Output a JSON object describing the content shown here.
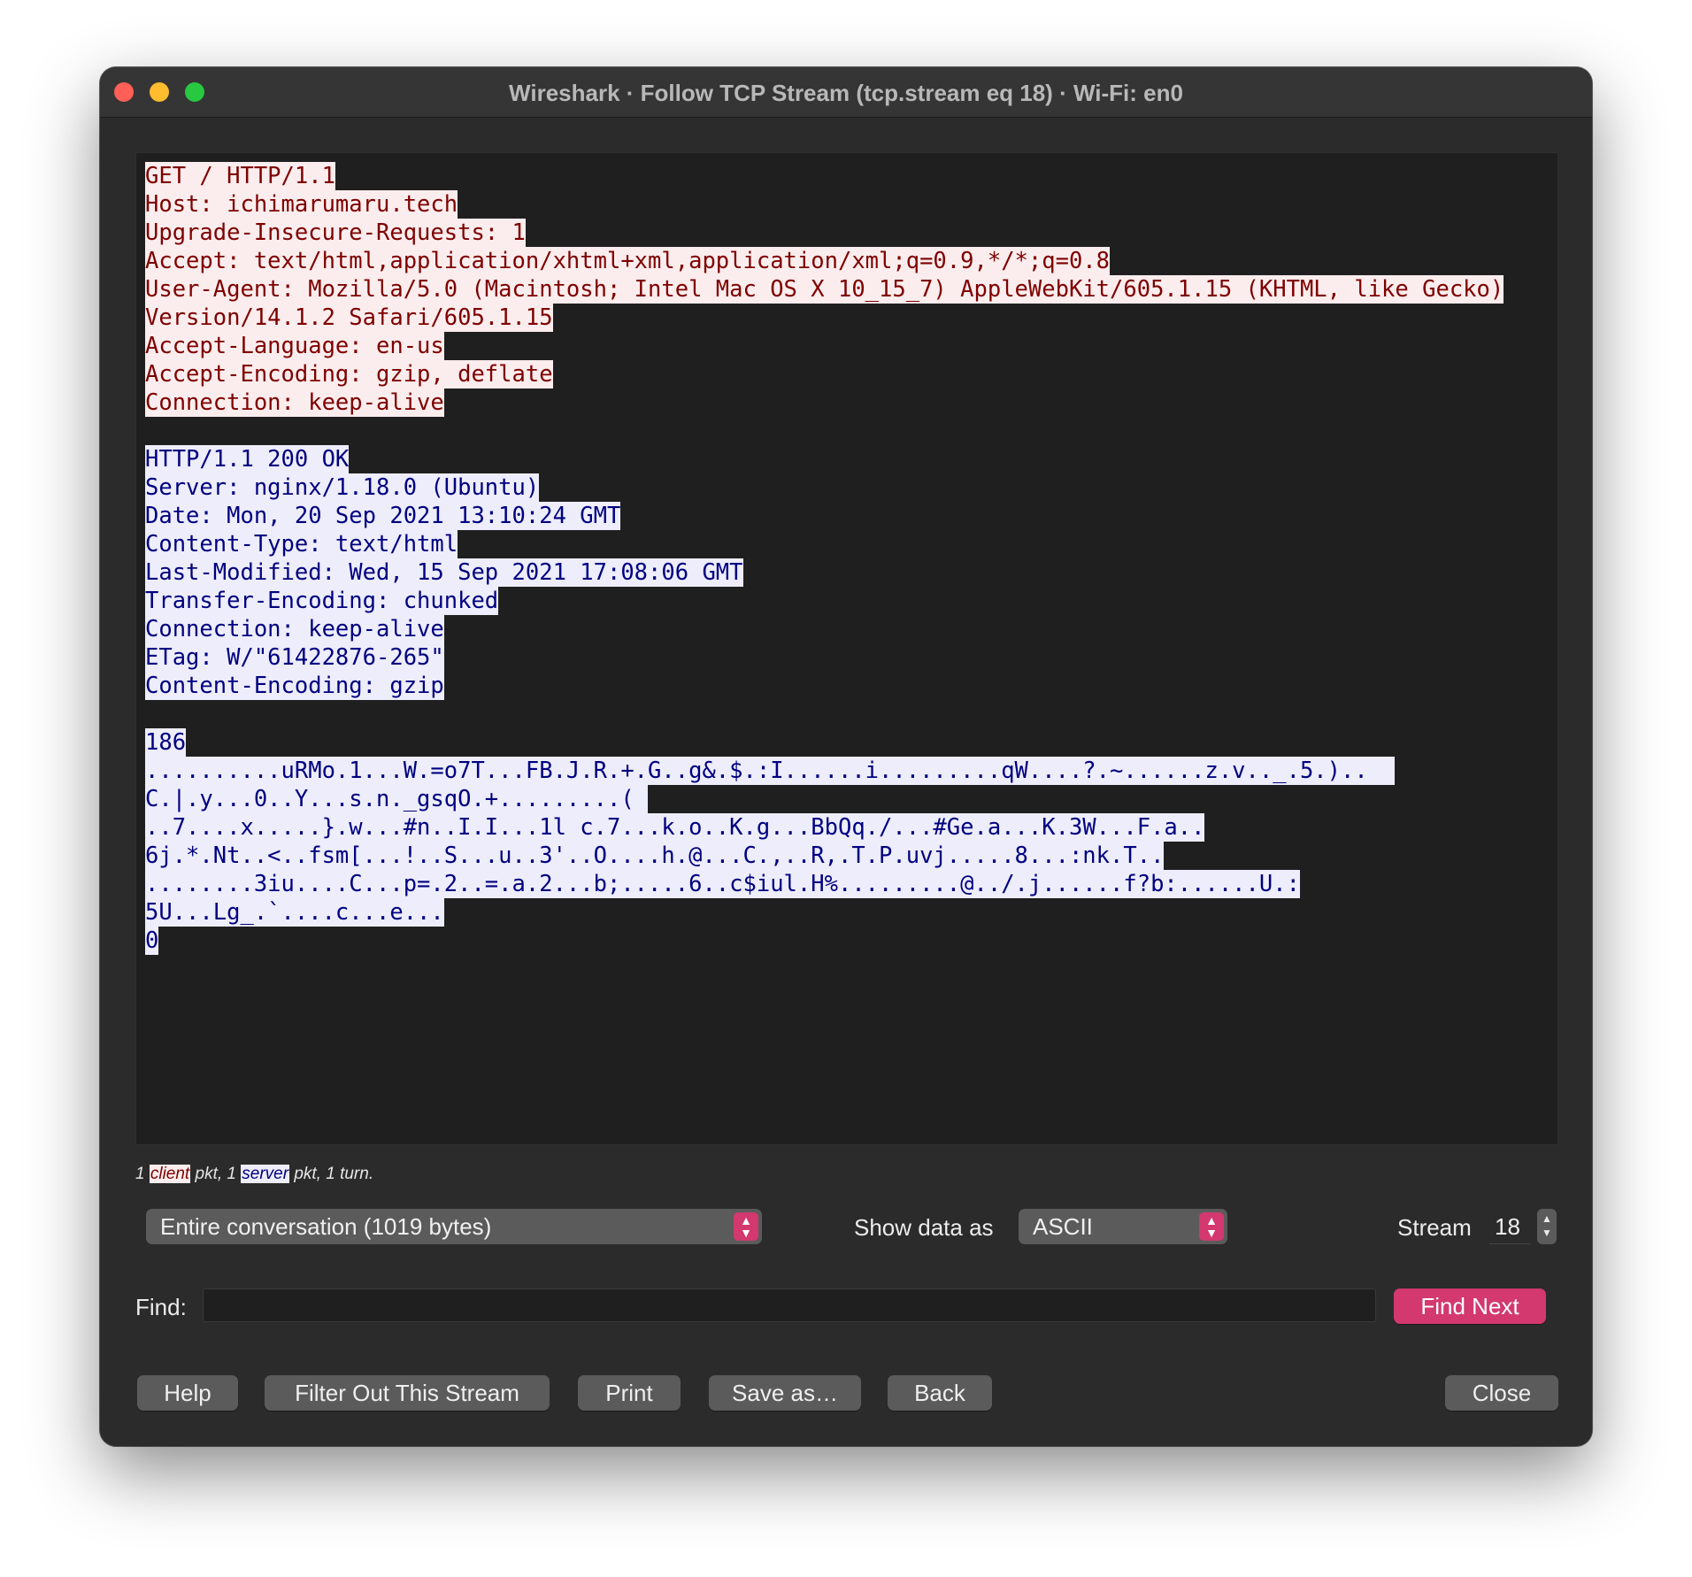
{
  "window": {
    "title": "Wireshark · Follow TCP Stream (tcp.stream eq 18) · Wi-Fi: en0"
  },
  "stream": {
    "client_lines": [
      "GET / HTTP/1.1",
      "Host: ichimarumaru.tech",
      "Upgrade-Insecure-Requests: 1",
      "Accept: text/html,application/xhtml+xml,application/xml;q=0.9,*/*;q=0.8",
      "User-Agent: Mozilla/5.0 (Macintosh; Intel Mac OS X 10_15_7) AppleWebKit/605.1.15 (KHTML, like Gecko)",
      "Version/14.1.2 Safari/605.1.15",
      "Accept-Language: en-us",
      "Accept-Encoding: gzip, deflate",
      "Connection: keep-alive"
    ],
    "server_lines": [
      "HTTP/1.1 200 OK",
      "Server: nginx/1.18.0 (Ubuntu)",
      "Date: Mon, 20 Sep 2021 13:10:24 GMT",
      "Content-Type: text/html",
      "Last-Modified: Wed, 15 Sep 2021 17:08:06 GMT",
      "Transfer-Encoding: chunked",
      "Connection: keep-alive",
      "ETag: W/\"61422876-265\"",
      "Content-Encoding: gzip"
    ],
    "server_body_lines": [
      "186",
      "..........uRMo.1...W.=o7T...FB.J.R.+.G..g&.$.:I......i.........qW....?.~......z.v.._.5.)..  ",
      "C.|.y...0..Y...s.n._gsqO.+.........( ",
      "..7....x.....}.w...#n..I.I...1l c.7...k.o..K.g...BbQq./...#Ge.a...K.3W...F.a..",
      "6j.*.Nt..<..fsm[...!..S...u..3'..O....h.@...C.,..R,.T.P.uvj.....8...:nk.T..",
      "........3iu....C...p=.2..=.a.2...b;.....6..c$iul.H%.........@../.j......f?b:......U.:",
      "5U...Lg_.`....c...e...",
      "0"
    ]
  },
  "stats": {
    "prefix": "1 ",
    "client": "client",
    "mid": " pkt, 1 ",
    "server": "server",
    "suffix": " pkt, 1 turn."
  },
  "controls": {
    "conversation": "Entire conversation (1019 bytes)",
    "show_data_label": "Show data as",
    "format": "ASCII",
    "stream_label": "Stream",
    "stream_value": "18",
    "find_label": "Find:",
    "find_value": "",
    "find_next": "Find Next"
  },
  "buttons": {
    "help": "Help",
    "filter": "Filter Out This Stream",
    "print": "Print",
    "save": "Save as…",
    "back": "Back",
    "close": "Close"
  },
  "colors": {
    "client_bg": "#fbeded",
    "client_fg": "#7f0000",
    "server_bg": "#ededfb",
    "server_fg": "#000080",
    "accent": "#d3386f"
  }
}
